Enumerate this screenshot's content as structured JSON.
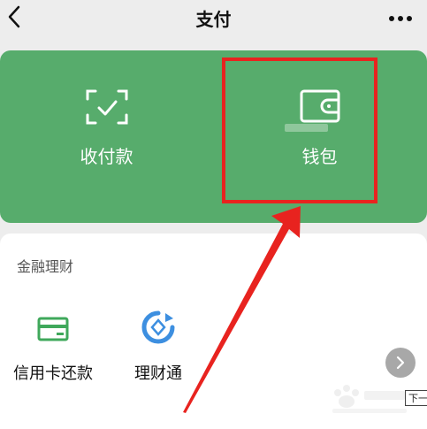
{
  "header": {
    "title": "支付",
    "back_icon": "chevron-left-icon",
    "more_icon": "more-dots-icon"
  },
  "main_tiles": [
    {
      "label": "收付款",
      "icon": "scan-pay-icon"
    },
    {
      "label": "钱包",
      "icon": "wallet-icon"
    }
  ],
  "finance": {
    "title": "金融理财",
    "items": [
      {
        "label": "信用卡还款",
        "icon": "credit-card-icon"
      },
      {
        "label": "理财通",
        "icon": "wealth-icon"
      }
    ]
  },
  "overlay": {
    "next_tooltip": "下一",
    "watermark_text": "jingyan.baidu.com"
  },
  "colors": {
    "green_card": "#57ac6c",
    "highlight": "#e8231f",
    "background": "#ededed",
    "icon_green": "#3fa85b",
    "icon_blue": "#3d8fe0"
  }
}
